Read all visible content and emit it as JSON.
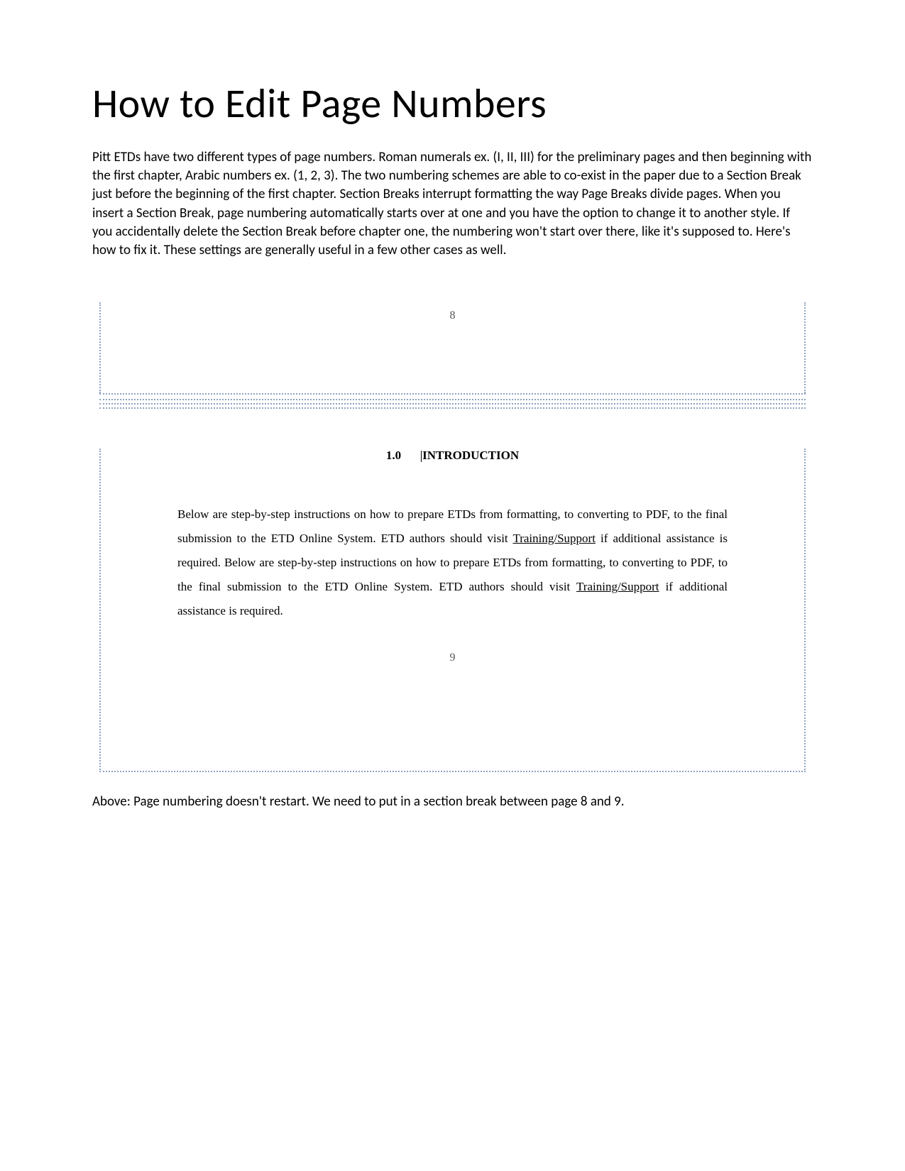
{
  "title": "How to Edit Page Numbers",
  "intro": "Pitt ETDs have two different types of page numbers.  Roman numerals ex. (I, II, III) for the preliminary pages and then beginning with the first chapter, Arabic numbers ex. (1, 2, 3).  The two numbering schemes are able to co-exist in the paper due to a Section Break just before the beginning of the first chapter.  Section Breaks interrupt formatting the way Page Breaks divide pages.  When you insert a Section Break, page numbering automatically starts over at one and you have the option to change it to another style.  If you accidentally delete the Section Break before chapter one, the numbering won't start over there, like it's supposed to.  Here's how to fix it.  These settings are generally useful in a few other cases as well.",
  "figure": {
    "page_num_top": "8",
    "chapter_number": "1.0",
    "chapter_title": "INTRODUCTION",
    "body_pre1": "Below are step-by-step instructions on how to prepare ETDs from formatting, to converting to PDF, to the final submission to the ETD Online System. ETD authors should visit ",
    "link1": "Training/Support",
    "body_mid": " if additional assistance is required. Below are step-by-step instructions on how to prepare ETDs from formatting, to converting to PDF, to the final submission to the ETD Online System. ETD authors should visit ",
    "link2": "Training/Support",
    "body_post": " if additional assistance is required.",
    "page_num_bottom": "9"
  },
  "caption": "Above: Page numbering doesn't restart.  We need to put in a section break between page 8 and 9."
}
